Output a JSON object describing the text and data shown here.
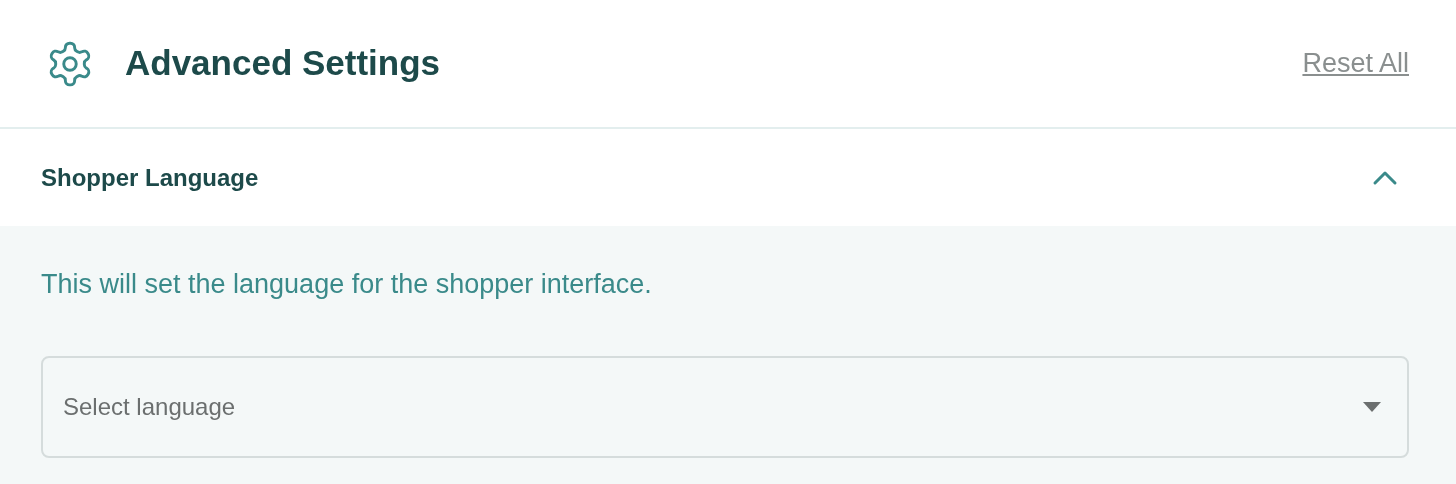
{
  "header": {
    "title": "Advanced Settings",
    "reset_link": "Reset All"
  },
  "section": {
    "title": "Shopper Language",
    "expanded": true,
    "description": "This will set the language for the shopper interface.",
    "select": {
      "placeholder": "Select language"
    }
  }
}
